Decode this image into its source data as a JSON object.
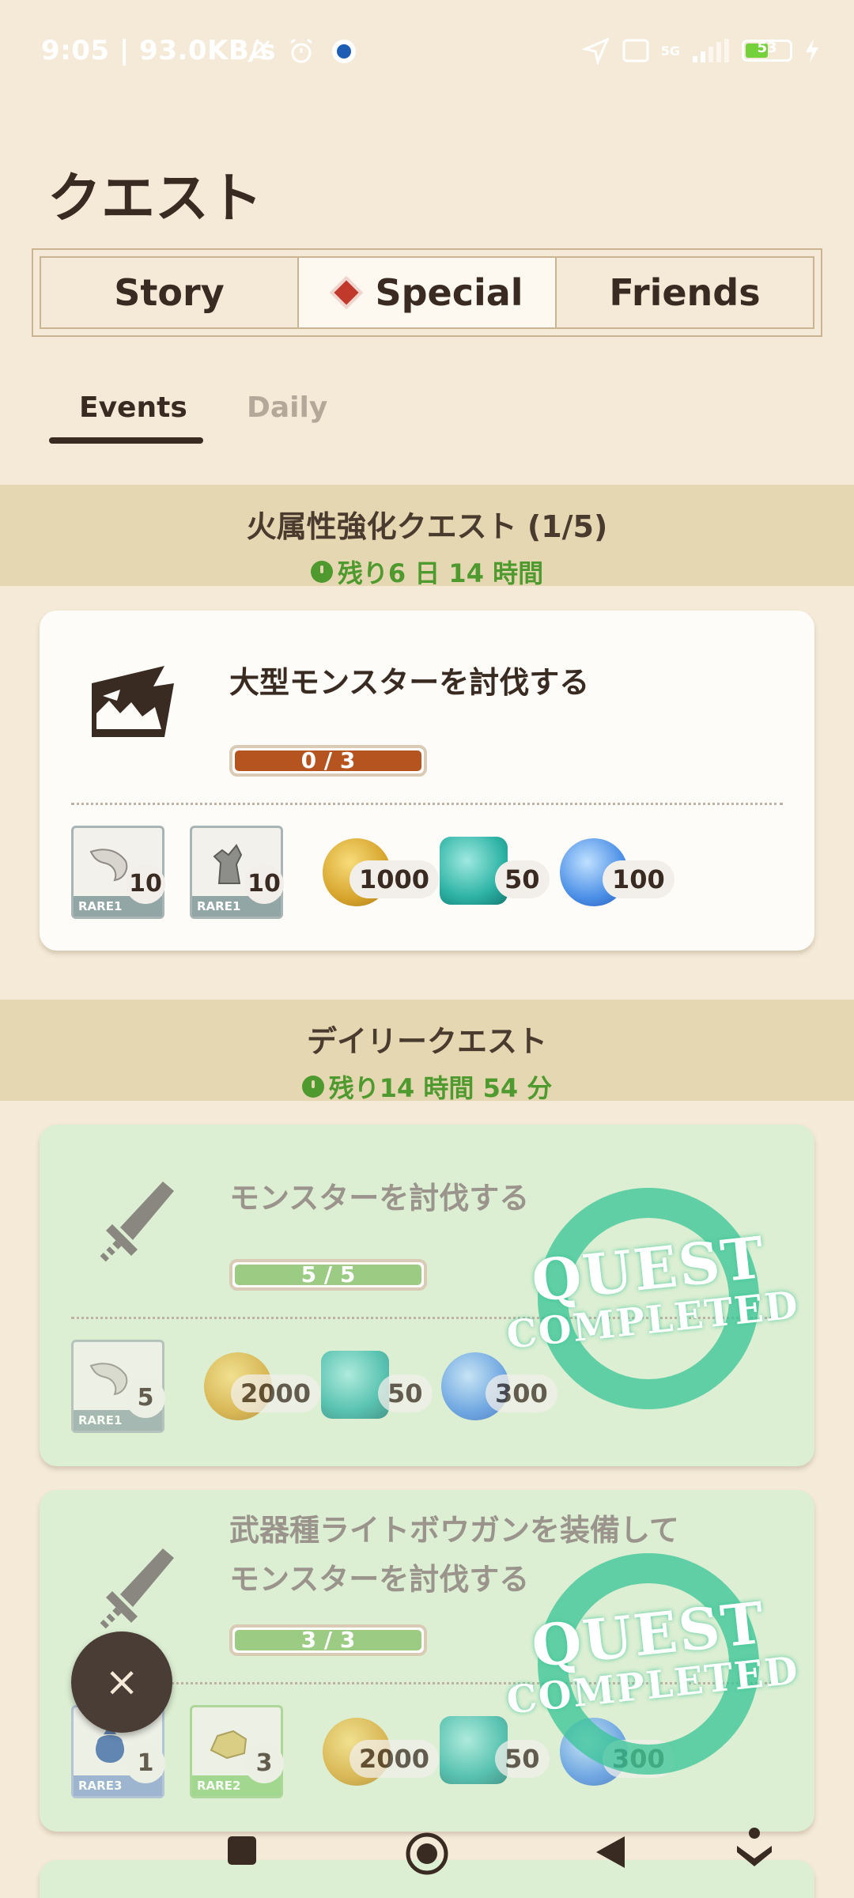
{
  "status_bar": {
    "time": "9:05 | 93.0KB/s",
    "battery": "53",
    "network": "5G"
  },
  "page": {
    "title": "クエスト"
  },
  "segments": [
    {
      "label": "Story",
      "active": false
    },
    {
      "label": "Special",
      "active": true,
      "icon": "special-diamond-icon"
    },
    {
      "label": "Friends",
      "active": false
    }
  ],
  "subtabs": [
    {
      "label": "Events",
      "active": true
    },
    {
      "label": "Daily",
      "active": false
    }
  ],
  "sections": [
    {
      "title": "火属性強化クエスト (1/5)",
      "time_left": "残り6 日 14 時間"
    },
    {
      "title": "デイリークエスト",
      "time_left": "残り14 時間 54 分"
    }
  ],
  "quests": [
    {
      "title": "大型モンスターを討伐する",
      "progress_text": "0 / 3",
      "progress": 0,
      "completed": false,
      "icon": "monster-jaw-icon",
      "rewards": {
        "items": [
          {
            "name": "horn-material-icon",
            "rare": "RARE1",
            "qty": "10"
          },
          {
            "name": "stone-figure-material-icon",
            "rare": "RARE1",
            "qty": "10"
          }
        ],
        "zenny": "1000",
        "gems": "50",
        "orbs": "100"
      }
    },
    {
      "title": "モンスターを討伐する",
      "progress_text": "5 / 5",
      "progress": 1,
      "completed": true,
      "icon": "sword-icon",
      "rewards": {
        "items": [
          {
            "name": "horn-material-icon",
            "rare": "RARE1",
            "qty": "5"
          }
        ],
        "zenny": "2000",
        "gems": "50",
        "orbs": "300"
      }
    },
    {
      "title_line1": "武器種ライトボウガンを装備して",
      "title_line2": "モンスターを討伐する",
      "progress_text": "3 / 3",
      "progress": 1,
      "completed": true,
      "icon": "sword-icon",
      "rewards": {
        "items": [
          {
            "name": "pouch-material-icon",
            "rare": "RARE3",
            "qty": "1"
          },
          {
            "name": "ore-material-icon",
            "rare": "RARE2",
            "qty": "3"
          }
        ],
        "zenny": "2000",
        "gems": "50",
        "orbs": "300"
      }
    }
  ],
  "stamp": {
    "line1": "QUEST",
    "line2": "COMPLETED"
  },
  "fab": {
    "label": "×"
  },
  "colors": {
    "background": "#f4ead7",
    "section_header": "#e6d7b3",
    "accent_green": "#4f9a2e",
    "progress_brown": "#b5541f",
    "progress_green": "#9ccc84",
    "completed_card": "#dcefd2"
  }
}
